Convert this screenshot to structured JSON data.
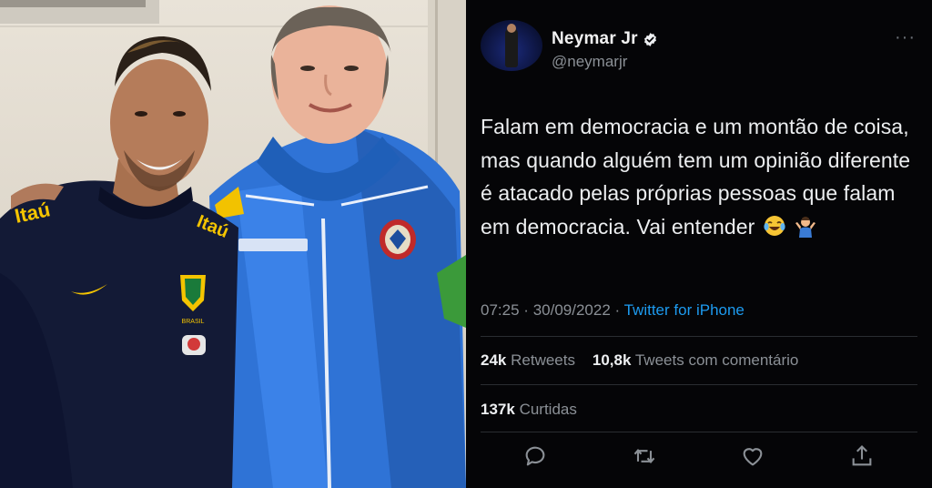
{
  "tweet": {
    "display_name": "Neymar Jr",
    "handle": "@neymarjr",
    "text": "Falam em democracia e um montão de coisa, mas quando alguém tem um opinião diferente é atacado pelas próprias pessoas que falam em democracia. Vai entender",
    "time": "07:25",
    "separator": "·",
    "date": "30/09/2022",
    "source": "Twitter for iPhone",
    "retweets_count": "24k",
    "retweets_label": "Retweets",
    "quotes_count": "10,8k",
    "quotes_label": "Tweets com comentário",
    "likes_count": "137k",
    "likes_label": "Curtidas",
    "more_glyph": "···"
  },
  "photo": {
    "jersey_brand": "Itaú",
    "crest_text": "BRASIL"
  },
  "colors": {
    "background": "#050507",
    "link": "#1d9bf0",
    "muted": "#8b9096",
    "divider": "#2a2d31"
  },
  "icons": [
    "verified-badge-icon",
    "more-icon",
    "reply-icon",
    "retweet-icon",
    "like-icon",
    "share-icon"
  ]
}
